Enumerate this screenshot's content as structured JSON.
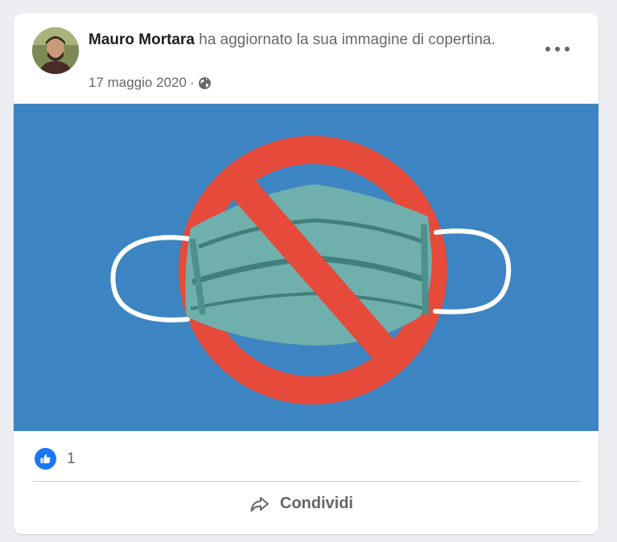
{
  "post": {
    "author": "Mauro Mortara",
    "action": " ha aggiornato la sua immagine di copertina.",
    "date": "17 maggio 2020",
    "separator": "·",
    "audience_icon": "globe-icon",
    "menu_icon": "more-options-icon"
  },
  "reactions": {
    "icon": "like-icon",
    "count": "1"
  },
  "actions": {
    "share_label": "Condividi",
    "share_icon": "share-arrow-icon"
  },
  "colors": {
    "cover_background": "#3d85c2",
    "prohibition_red": "#e54a3a",
    "mask_teal": "#6fb0ad",
    "like_blue": "#1877f2"
  }
}
